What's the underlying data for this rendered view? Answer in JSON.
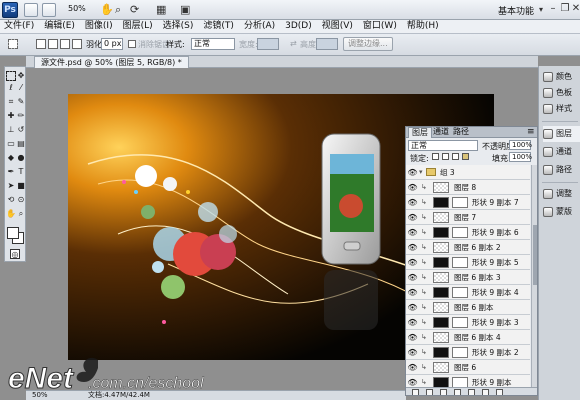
{
  "app": {
    "logo": "Ps",
    "zoom": "50%",
    "workspace": "基本功能"
  },
  "menu": [
    "文件(F)",
    "编辑(E)",
    "图像(I)",
    "图层(L)",
    "选择(S)",
    "滤镜(T)",
    "分析(A)",
    "3D(D)",
    "视图(V)",
    "窗口(W)",
    "帮助(H)"
  ],
  "options": {
    "feather_label": "羽化:",
    "feather_value": "0 px",
    "antialias_label": "消除锯齿",
    "style_label": "样式:",
    "style_value": "正常",
    "width_label": "宽度:",
    "height_label": "高度:",
    "refine_edge": "调整边缘..."
  },
  "document": {
    "tab_title": "源文件.psd @ 50% (图层 5, RGB/8) *",
    "zoom": "50%",
    "doc_size": "文档:4.47M/42.4M"
  },
  "dock": [
    "颜色",
    "色板",
    "样式",
    "图层",
    "通道",
    "路径",
    "调整",
    "蒙版"
  ],
  "layers_panel": {
    "tabs": [
      "图层",
      "通道",
      "路径"
    ],
    "blend_mode": "正常",
    "opacity_label": "不透明度:",
    "opacity_value": "100%",
    "lock_label": "锁定:",
    "fill_label": "填充:",
    "fill_value": "100%",
    "group_name": "组 3",
    "rows": [
      {
        "name": "图层 8",
        "kind": "layer"
      },
      {
        "name": "形状 9 副本 7",
        "kind": "shape"
      },
      {
        "name": "图层 7",
        "kind": "layer"
      },
      {
        "name": "形状 9 副本 6",
        "kind": "shape"
      },
      {
        "name": "图层 6 副本 2",
        "kind": "layer"
      },
      {
        "name": "形状 9 副本 5",
        "kind": "shape"
      },
      {
        "name": "图层 6 副本 3",
        "kind": "layer"
      },
      {
        "name": "形状 9 副本 4",
        "kind": "shape"
      },
      {
        "name": "图层 6 副本",
        "kind": "layer"
      },
      {
        "name": "形状 9 副本 3",
        "kind": "shape"
      },
      {
        "name": "图层 6 副本 4",
        "kind": "layer"
      },
      {
        "name": "形状 9 副本 2",
        "kind": "shape"
      },
      {
        "name": "图层 6",
        "kind": "layer"
      },
      {
        "name": "形状 9 副本",
        "kind": "shape"
      }
    ]
  },
  "watermark": {
    "brand": "eNet",
    "domain": ".com.cn/eschool"
  }
}
